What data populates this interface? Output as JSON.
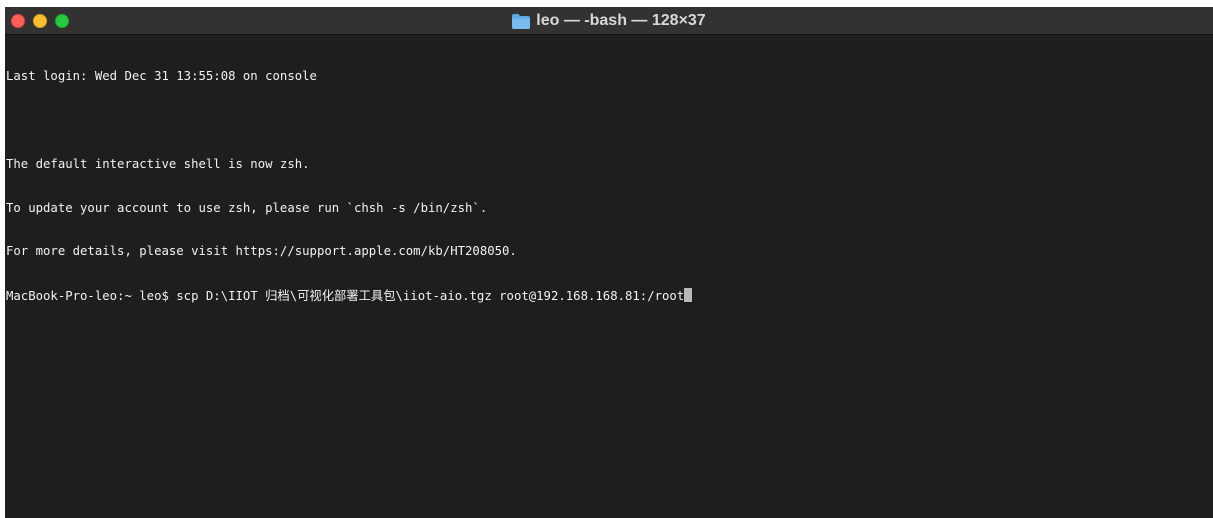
{
  "window": {
    "title": "leo — -bash — 128×37",
    "title_icon": "folder-icon",
    "traffic_lights": {
      "close_color": "#fe5f57",
      "minimize_color": "#febc2e",
      "maximize_color": "#28c840"
    }
  },
  "terminal": {
    "lines": [
      "Last login: Wed Dec 31 13:55:08 on console",
      "",
      "The default interactive shell is now zsh.",
      "To update your account to use zsh, please run `chsh -s /bin/zsh`.",
      "For more details, please visit https://support.apple.com/kb/HT208050."
    ],
    "prompt": "MacBook-Pro-leo:~ leo$ ",
    "command": "scp D:\\IIOT 归档\\可视化部署工具包\\iiot-aio.tgz root@192.168.168.81:/root",
    "background": "#1e1e1e",
    "foreground": "#f2f2f2"
  }
}
